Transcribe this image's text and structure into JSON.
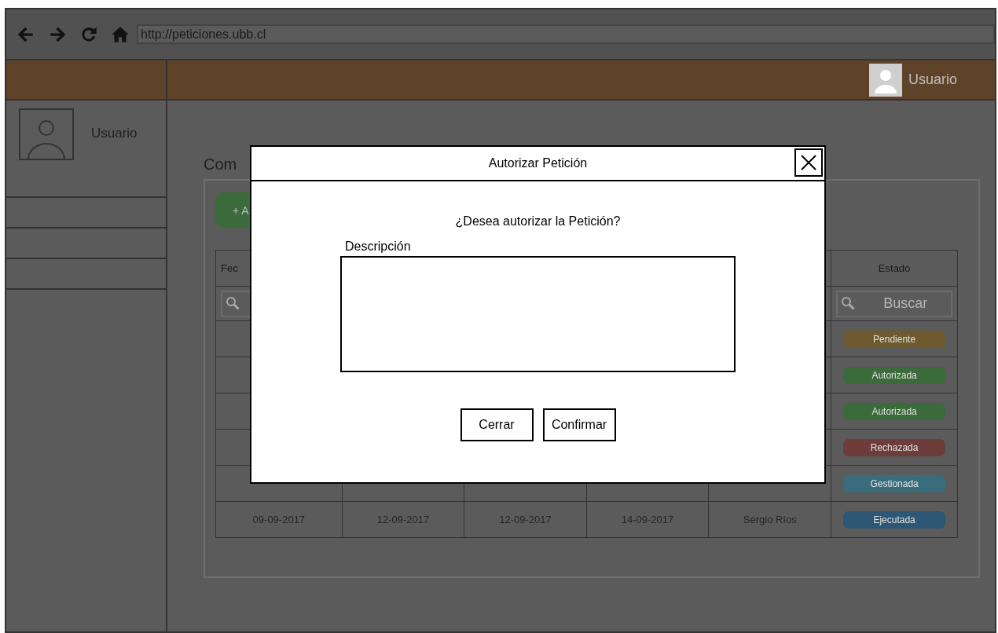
{
  "browser": {
    "url": "http://peticiones.ubb.cl"
  },
  "header": {
    "user": "Usuario"
  },
  "sidebar": {
    "user": "Usuario"
  },
  "page": {
    "title": "Com",
    "add_button": "+ A"
  },
  "table": {
    "columns": [
      "Fec",
      "",
      "",
      "",
      "",
      "Estado"
    ],
    "search_placeholder": "Buscar",
    "rows": [
      {
        "status": {
          "label": "Pendiente",
          "color": "#6e5a2f"
        }
      },
      {
        "status": {
          "label": "Autorizada",
          "color": "#3b6a3b"
        }
      },
      {
        "status": {
          "label": "Autorizada",
          "color": "#3b6a3b"
        }
      },
      {
        "status": {
          "label": "Rechazada",
          "color": "#6e3c3a"
        }
      },
      {
        "status": {
          "label": "Gestionada",
          "color": "#3a6d7c"
        }
      },
      {
        "cells": [
          "09-09-2017",
          "12-09-2017",
          "12-09-2017",
          "14-09-2017",
          "Sergio Ríos"
        ],
        "status": {
          "label": "Ejecutada",
          "color": "#2d5774"
        }
      }
    ]
  },
  "dialog": {
    "title": "Autorizar Petición",
    "question": "¿Desea autorizar la Petición?",
    "field_label": "Descripción",
    "buttons": [
      "Cerrar",
      "Confirmar"
    ]
  }
}
